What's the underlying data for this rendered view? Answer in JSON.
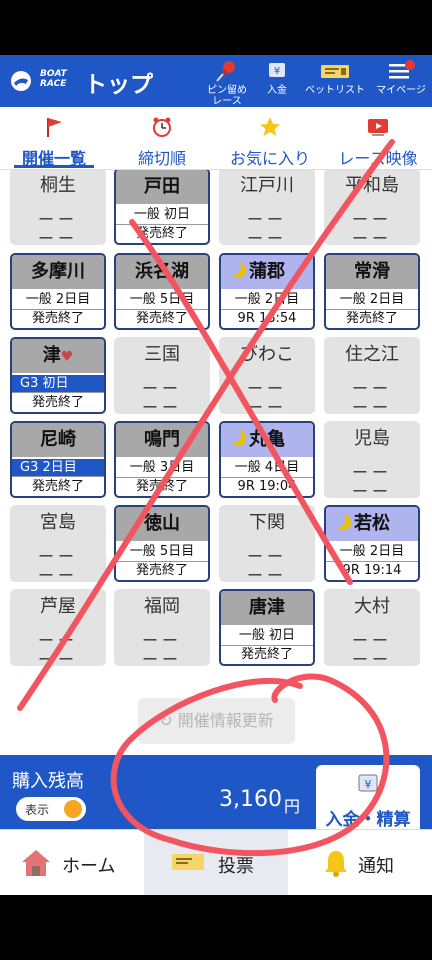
{
  "header": {
    "logo_text": [
      "BOAT",
      "RACE"
    ],
    "title": "トップ",
    "buttons": [
      {
        "label_line1": "ピン留め",
        "label_line2": "レース",
        "icon": "pin-icon"
      },
      {
        "label_line1": "入金",
        "label_line2": "",
        "icon": "deposit-icon"
      },
      {
        "label_line1": "ベットリスト",
        "label_line2": "",
        "icon": "betlist-icon"
      },
      {
        "label_line1": "マイページ",
        "label_line2": "",
        "icon": "menu-icon"
      }
    ]
  },
  "tabs": [
    {
      "label": "開催一覧",
      "icon": "flag-icon",
      "active": true
    },
    {
      "label": "締切順",
      "icon": "alarm-clock-icon",
      "active": false
    },
    {
      "label": "お気に入り",
      "icon": "star-icon",
      "active": false
    },
    {
      "label": "レース映像",
      "icon": "video-icon",
      "active": false
    }
  ],
  "venues": [
    {
      "name": "桐生",
      "state": "off"
    },
    {
      "name": "戸田",
      "state": "on",
      "line1": "一般 初日",
      "line2": "発売終了"
    },
    {
      "name": "江戸川",
      "state": "off"
    },
    {
      "name": "平和島",
      "state": "off"
    },
    {
      "name": "多摩川",
      "state": "on",
      "line1": "一般 2日目",
      "line2": "発売終了"
    },
    {
      "name": "浜名湖",
      "state": "on",
      "line1": "一般 5日目",
      "line2": "発売終了"
    },
    {
      "name": "蒲郡",
      "state": "on",
      "night": true,
      "line1": "一般 2日目",
      "line2": "9R 18:54"
    },
    {
      "name": "常滑",
      "state": "on",
      "line1": "一般 2日目",
      "line2": "発売終了"
    },
    {
      "name": "津",
      "state": "on",
      "heart": true,
      "g3": true,
      "line1": "G3 初日",
      "line2": "発売終了"
    },
    {
      "name": "三国",
      "state": "off"
    },
    {
      "name": "びわこ",
      "state": "off"
    },
    {
      "name": "住之江",
      "state": "off"
    },
    {
      "name": "尼崎",
      "state": "on",
      "g3": true,
      "line1": "G3 2日目",
      "line2": "発売終了"
    },
    {
      "name": "鳴門",
      "state": "on",
      "line1": "一般 3日目",
      "line2": "発売終了"
    },
    {
      "name": "丸亀",
      "state": "on",
      "night": true,
      "line1": "一般 4日目",
      "line2": "9R 19:04"
    },
    {
      "name": "児島",
      "state": "off"
    },
    {
      "name": "宮島",
      "state": "off"
    },
    {
      "name": "徳山",
      "state": "on",
      "line1": "一般 5日目",
      "line2": "発売終了"
    },
    {
      "name": "下関",
      "state": "off"
    },
    {
      "name": "若松",
      "state": "on",
      "night": true,
      "line1": "一般 2日目",
      "line2": "9R 19:14"
    },
    {
      "name": "芦屋",
      "state": "off"
    },
    {
      "name": "福岡",
      "state": "off"
    },
    {
      "name": "唐津",
      "state": "on",
      "line1": "一般 初日",
      "line2": "発売終了"
    },
    {
      "name": "大村",
      "state": "off"
    }
  ],
  "empty_marker": "ーー",
  "refresh_label": "開催情報更新",
  "balance": {
    "label": "購入残高",
    "toggle_label": "表示",
    "amount": "3,160",
    "unit": "円",
    "deposit_button": "入金・精算"
  },
  "bottom_nav": [
    {
      "label": "ホーム",
      "icon": "home-icon"
    },
    {
      "label": "投票",
      "icon": "ticket-icon"
    },
    {
      "label": "通知",
      "icon": "bell-icon"
    }
  ],
  "colors": {
    "brand": "#1f57c6",
    "night": "#b0b4ee",
    "annotation": "#f2555f"
  }
}
